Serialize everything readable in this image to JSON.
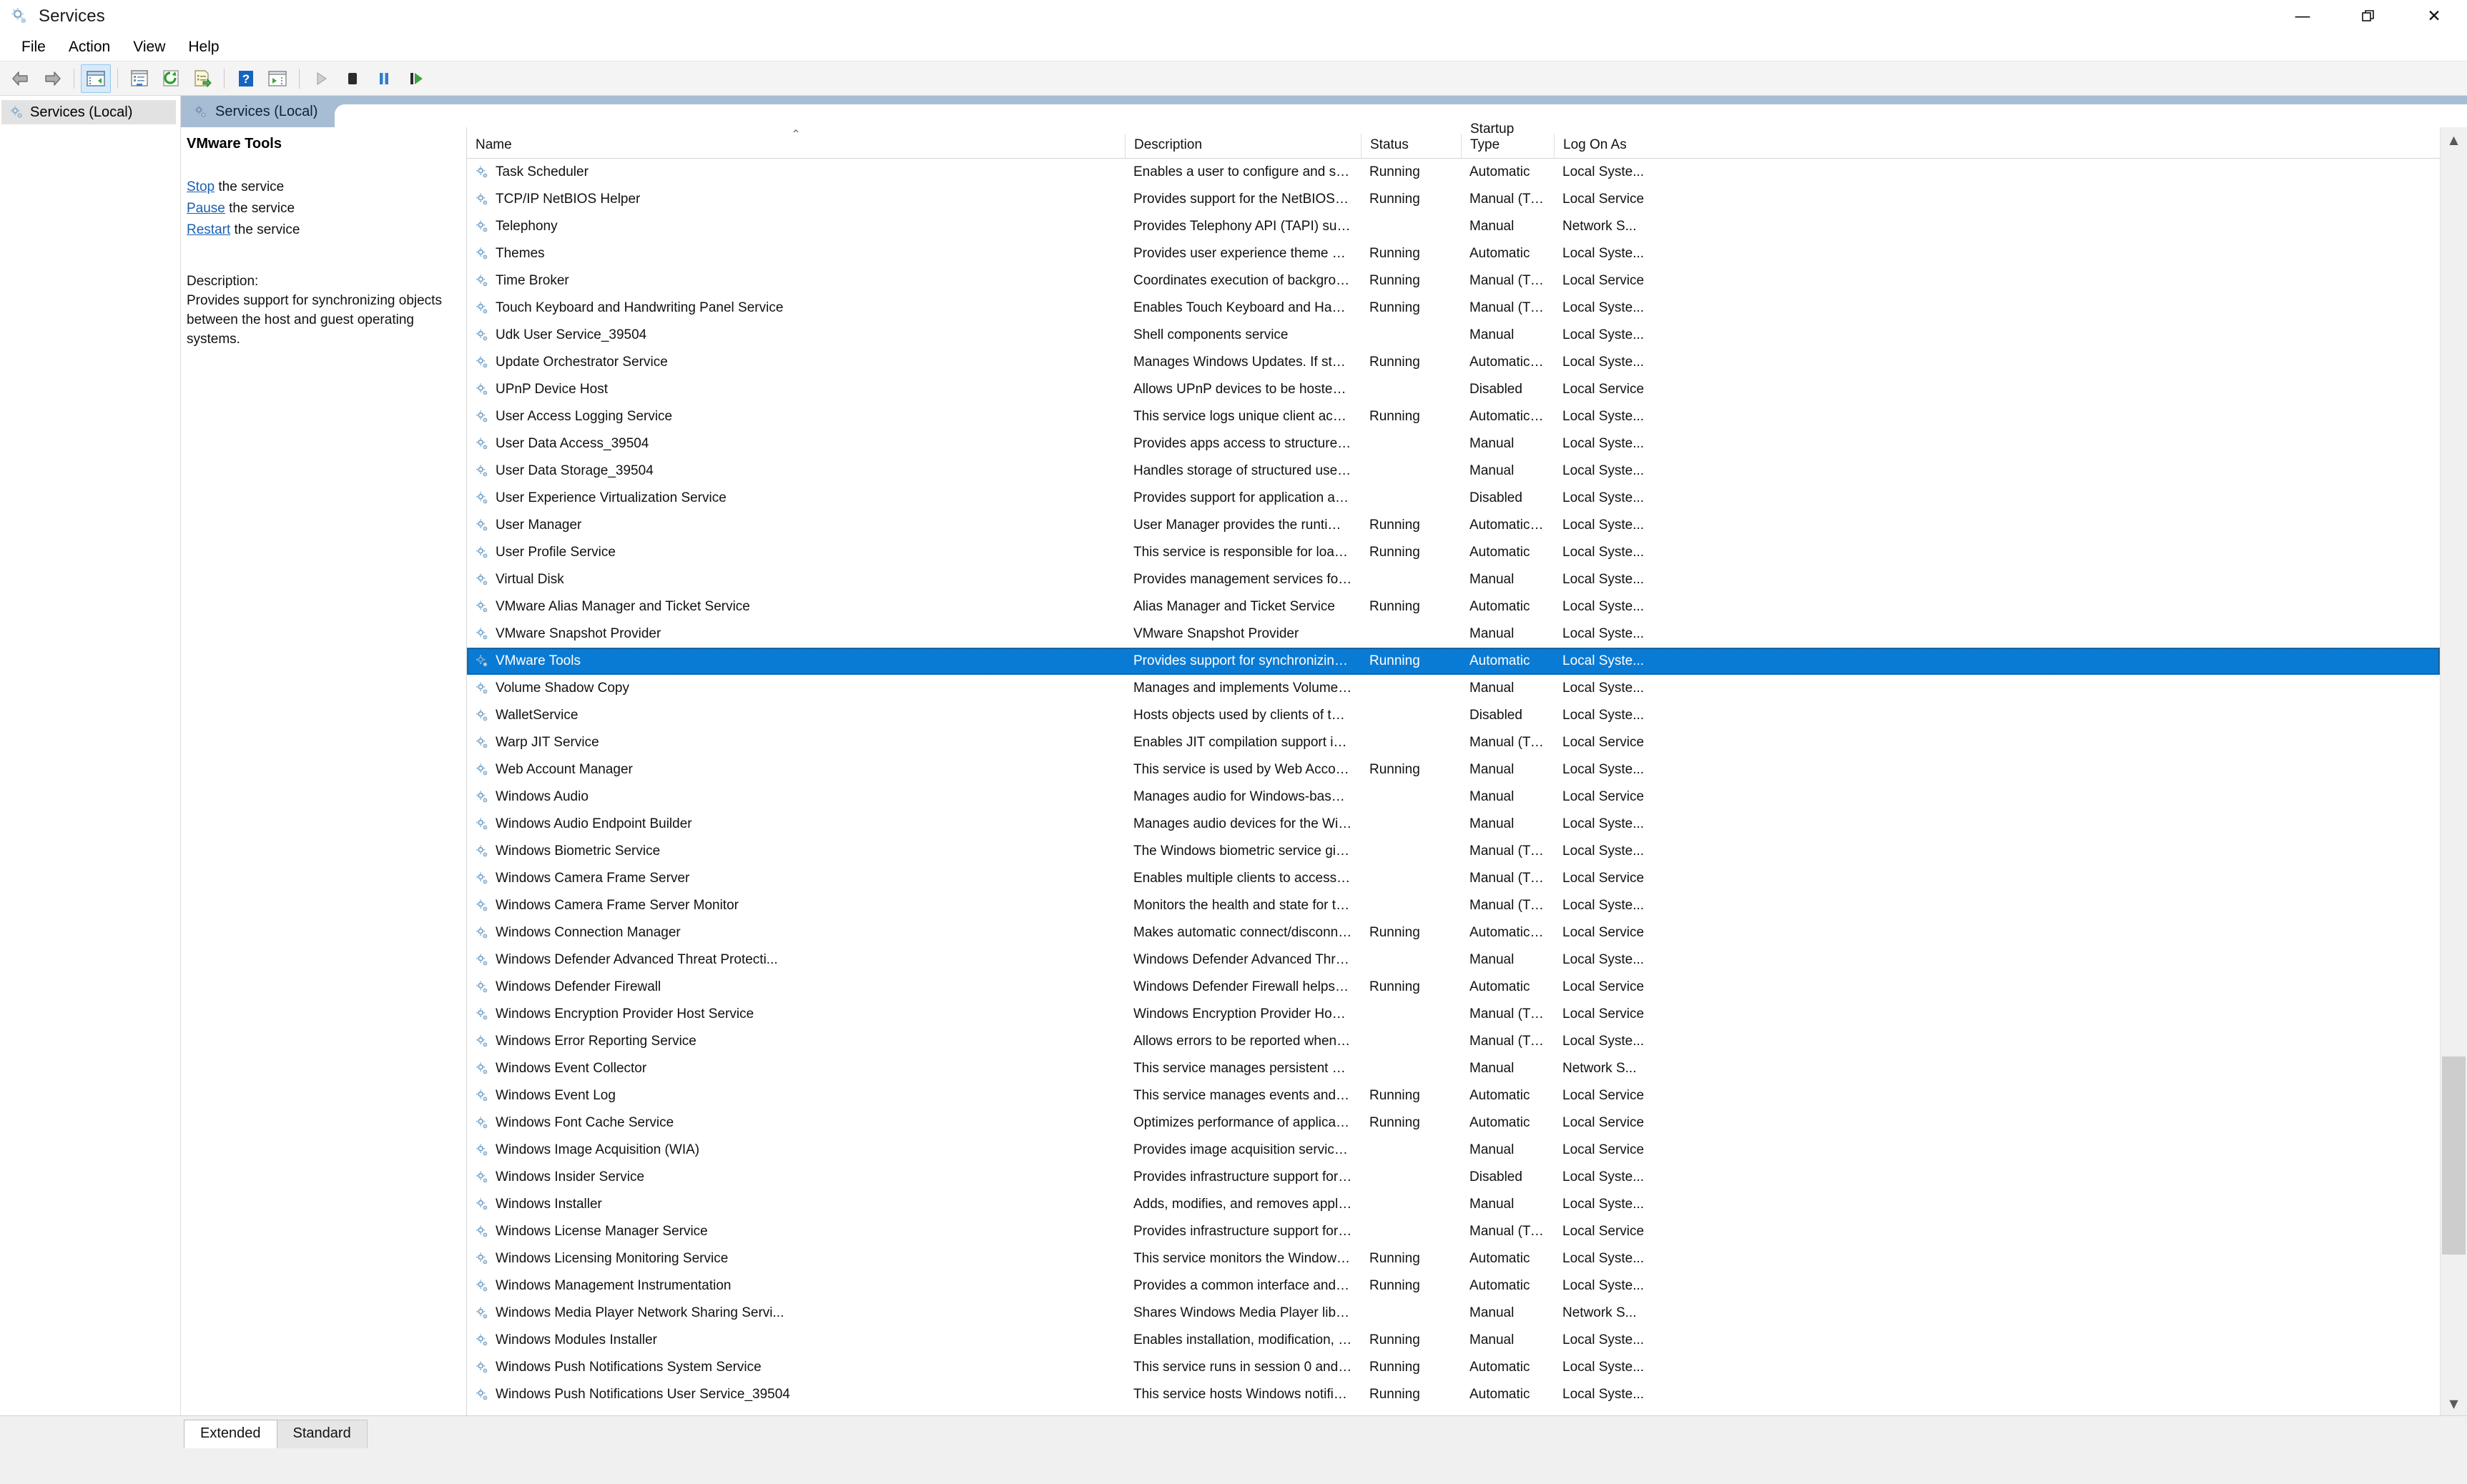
{
  "window": {
    "title": "Services",
    "app_icon": "services-gear-icon",
    "controls": {
      "minimize": "minimize-icon",
      "restore": "restore-icon",
      "close": "close-icon"
    }
  },
  "menubar": {
    "items": [
      "File",
      "Action",
      "View",
      "Help"
    ]
  },
  "toolbar": {
    "buttons": [
      {
        "name": "back-icon",
        "glyph": "back"
      },
      {
        "name": "forward-icon",
        "glyph": "forward"
      },
      {
        "name": "show-hide-console-tree-icon",
        "glyph": "tree",
        "active": true
      },
      {
        "name": "properties-icon",
        "glyph": "properties"
      },
      {
        "name": "refresh-icon",
        "glyph": "refresh"
      },
      {
        "name": "export-list-icon",
        "glyph": "export"
      },
      {
        "name": "help-icon",
        "glyph": "help"
      },
      {
        "name": "show-action-pane-icon",
        "glyph": "actionpane"
      },
      {
        "name": "start-service-icon",
        "glyph": "play"
      },
      {
        "name": "stop-service-icon",
        "glyph": "stop"
      },
      {
        "name": "pause-service-icon",
        "glyph": "pause"
      },
      {
        "name": "restart-service-icon",
        "glyph": "restart"
      }
    ]
  },
  "tree": {
    "root_label": "Services (Local)",
    "root_icon": "services-gear-icon"
  },
  "pane_header": {
    "label": "Services (Local)",
    "icon": "services-gear-icon"
  },
  "details": {
    "service_name": "VMware Tools",
    "links": [
      {
        "link": "Stop",
        "suffix": " the service"
      },
      {
        "link": "Pause",
        "suffix": " the service"
      },
      {
        "link": "Restart",
        "suffix": " the service"
      }
    ],
    "description_label": "Description:",
    "description": "Provides support for synchronizing objects between the host and guest operating systems."
  },
  "list": {
    "columns": [
      "Name",
      "Description",
      "Status",
      "Startup Type",
      "Log On As"
    ],
    "sort_column": "Name",
    "sort_direction": "ascending",
    "selected_row": "VMware Tools",
    "rows": [
      {
        "name": "Task Scheduler",
        "description": "Enables a user to configure and sche...",
        "status": "Running",
        "startup": "Automatic",
        "logon": "Local Syste..."
      },
      {
        "name": "TCP/IP NetBIOS Helper",
        "description": "Provides support for the NetBIOS ov...",
        "status": "Running",
        "startup": "Manual (Trig...",
        "logon": "Local Service"
      },
      {
        "name": "Telephony",
        "description": "Provides Telephony API (TAPI) suppo...",
        "status": "",
        "startup": "Manual",
        "logon": "Network S..."
      },
      {
        "name": "Themes",
        "description": "Provides user experience theme ma...",
        "status": "Running",
        "startup": "Automatic",
        "logon": "Local Syste..."
      },
      {
        "name": "Time Broker",
        "description": "Coordinates execution of backgroun...",
        "status": "Running",
        "startup": "Manual (Trig...",
        "logon": "Local Service"
      },
      {
        "name": "Touch Keyboard and Handwriting Panel Service",
        "description": "Enables Touch Keyboard and Handw...",
        "status": "Running",
        "startup": "Manual (Trig...",
        "logon": "Local Syste..."
      },
      {
        "name": "Udk User Service_39504",
        "description": "Shell components service",
        "status": "",
        "startup": "Manual",
        "logon": "Local Syste..."
      },
      {
        "name": "Update Orchestrator Service",
        "description": "Manages Windows Updates. If stopp...",
        "status": "Running",
        "startup": "Automatic (...",
        "logon": "Local Syste..."
      },
      {
        "name": "UPnP Device Host",
        "description": "Allows UPnP devices to be hosted o...",
        "status": "",
        "startup": "Disabled",
        "logon": "Local Service"
      },
      {
        "name": "User Access Logging Service",
        "description": "This service logs unique client acces...",
        "status": "Running",
        "startup": "Automatic (...",
        "logon": "Local Syste..."
      },
      {
        "name": "User Data Access_39504",
        "description": "Provides apps access to structured u...",
        "status": "",
        "startup": "Manual",
        "logon": "Local Syste..."
      },
      {
        "name": "User Data Storage_39504",
        "description": "Handles storage of structured user d...",
        "status": "",
        "startup": "Manual",
        "logon": "Local Syste..."
      },
      {
        "name": "User Experience Virtualization Service",
        "description": "Provides support for application and...",
        "status": "",
        "startup": "Disabled",
        "logon": "Local Syste..."
      },
      {
        "name": "User Manager",
        "description": "User Manager provides the runtime ...",
        "status": "Running",
        "startup": "Automatic (T...",
        "logon": "Local Syste..."
      },
      {
        "name": "User Profile Service",
        "description": "This service is responsible for loadin...",
        "status": "Running",
        "startup": "Automatic",
        "logon": "Local Syste..."
      },
      {
        "name": "Virtual Disk",
        "description": "Provides management services for d...",
        "status": "",
        "startup": "Manual",
        "logon": "Local Syste..."
      },
      {
        "name": "VMware Alias Manager and Ticket Service",
        "description": "Alias Manager and Ticket Service",
        "status": "Running",
        "startup": "Automatic",
        "logon": "Local Syste..."
      },
      {
        "name": "VMware Snapshot Provider",
        "description": "VMware Snapshot Provider",
        "status": "",
        "startup": "Manual",
        "logon": "Local Syste..."
      },
      {
        "name": "VMware Tools",
        "description": "Provides support for synchronizing ...",
        "status": "Running",
        "startup": "Automatic",
        "logon": "Local Syste...",
        "selected": true
      },
      {
        "name": "Volume Shadow Copy",
        "description": "Manages and implements Volume S...",
        "status": "",
        "startup": "Manual",
        "logon": "Local Syste..."
      },
      {
        "name": "WalletService",
        "description": "Hosts objects used by clients of the ...",
        "status": "",
        "startup": "Disabled",
        "logon": "Local Syste..."
      },
      {
        "name": "Warp JIT Service",
        "description": "Enables JIT compilation support in d...",
        "status": "",
        "startup": "Manual (Trig...",
        "logon": "Local Service"
      },
      {
        "name": "Web Account Manager",
        "description": "This service is used by Web Account ...",
        "status": "Running",
        "startup": "Manual",
        "logon": "Local Syste..."
      },
      {
        "name": "Windows Audio",
        "description": "Manages audio for Windows-based ...",
        "status": "",
        "startup": "Manual",
        "logon": "Local Service"
      },
      {
        "name": "Windows Audio Endpoint Builder",
        "description": "Manages audio devices for the Wind...",
        "status": "",
        "startup": "Manual",
        "logon": "Local Syste..."
      },
      {
        "name": "Windows Biometric Service",
        "description": "The Windows biometric service give...",
        "status": "",
        "startup": "Manual (Trig...",
        "logon": "Local Syste..."
      },
      {
        "name": "Windows Camera Frame Server",
        "description": "Enables multiple clients to access vi...",
        "status": "",
        "startup": "Manual (Trig...",
        "logon": "Local Service"
      },
      {
        "name": "Windows Camera Frame Server Monitor",
        "description": "Monitors the health and state for the...",
        "status": "",
        "startup": "Manual (Trig...",
        "logon": "Local Syste..."
      },
      {
        "name": "Windows Connection Manager",
        "description": "Makes automatic connect/disconne...",
        "status": "Running",
        "startup": "Automatic (T...",
        "logon": "Local Service"
      },
      {
        "name": "Windows Defender Advanced Threat Protecti...",
        "description": "Windows Defender Advanced Threat...",
        "status": "",
        "startup": "Manual",
        "logon": "Local Syste..."
      },
      {
        "name": "Windows Defender Firewall",
        "description": "Windows Defender Firewall helps pr...",
        "status": "Running",
        "startup": "Automatic",
        "logon": "Local Service"
      },
      {
        "name": "Windows Encryption Provider Host Service",
        "description": "Windows Encryption Provider Host S...",
        "status": "",
        "startup": "Manual (Trig...",
        "logon": "Local Service"
      },
      {
        "name": "Windows Error Reporting Service",
        "description": "Allows errors to be reported when pr...",
        "status": "",
        "startup": "Manual (Trig...",
        "logon": "Local Syste..."
      },
      {
        "name": "Windows Event Collector",
        "description": "This service manages persistent subs...",
        "status": "",
        "startup": "Manual",
        "logon": "Network S..."
      },
      {
        "name": "Windows Event Log",
        "description": "This service manages events and eve...",
        "status": "Running",
        "startup": "Automatic",
        "logon": "Local Service"
      },
      {
        "name": "Windows Font Cache Service",
        "description": "Optimizes performance of applicatio...",
        "status": "Running",
        "startup": "Automatic",
        "logon": "Local Service"
      },
      {
        "name": "Windows Image Acquisition (WIA)",
        "description": "Provides image acquisition services f...",
        "status": "",
        "startup": "Manual",
        "logon": "Local Service"
      },
      {
        "name": "Windows Insider Service",
        "description": "Provides infrastructure support for t...",
        "status": "",
        "startup": "Disabled",
        "logon": "Local Syste..."
      },
      {
        "name": "Windows Installer",
        "description": "Adds, modifies, and removes applic...",
        "status": "",
        "startup": "Manual",
        "logon": "Local Syste..."
      },
      {
        "name": "Windows License Manager Service",
        "description": "Provides infrastructure support for t...",
        "status": "",
        "startup": "Manual (Trig...",
        "logon": "Local Service"
      },
      {
        "name": "Windows Licensing Monitoring Service",
        "description": "This service monitors the Windows s...",
        "status": "Running",
        "startup": "Automatic",
        "logon": "Local Syste..."
      },
      {
        "name": "Windows Management Instrumentation",
        "description": "Provides a common interface and o...",
        "status": "Running",
        "startup": "Automatic",
        "logon": "Local Syste..."
      },
      {
        "name": "Windows Media Player Network Sharing Servi...",
        "description": "Shares Windows Media Player librari...",
        "status": "",
        "startup": "Manual",
        "logon": "Network S..."
      },
      {
        "name": "Windows Modules Installer",
        "description": "Enables installation, modification, a...",
        "status": "Running",
        "startup": "Manual",
        "logon": "Local Syste..."
      },
      {
        "name": "Windows Push Notifications System Service",
        "description": "This service runs in session 0 and ho...",
        "status": "Running",
        "startup": "Automatic",
        "logon": "Local Syste..."
      },
      {
        "name": "Windows Push Notifications User Service_39504",
        "description": "This service hosts Windows notificati...",
        "status": "Running",
        "startup": "Automatic",
        "logon": "Local Syste..."
      }
    ]
  },
  "tabs": {
    "items": [
      "Extended",
      "Standard"
    ],
    "active": "Extended"
  },
  "colors": {
    "selection": "#0a7bd4",
    "header_band": "#a7bdd4",
    "link": "#1a5fb4"
  }
}
